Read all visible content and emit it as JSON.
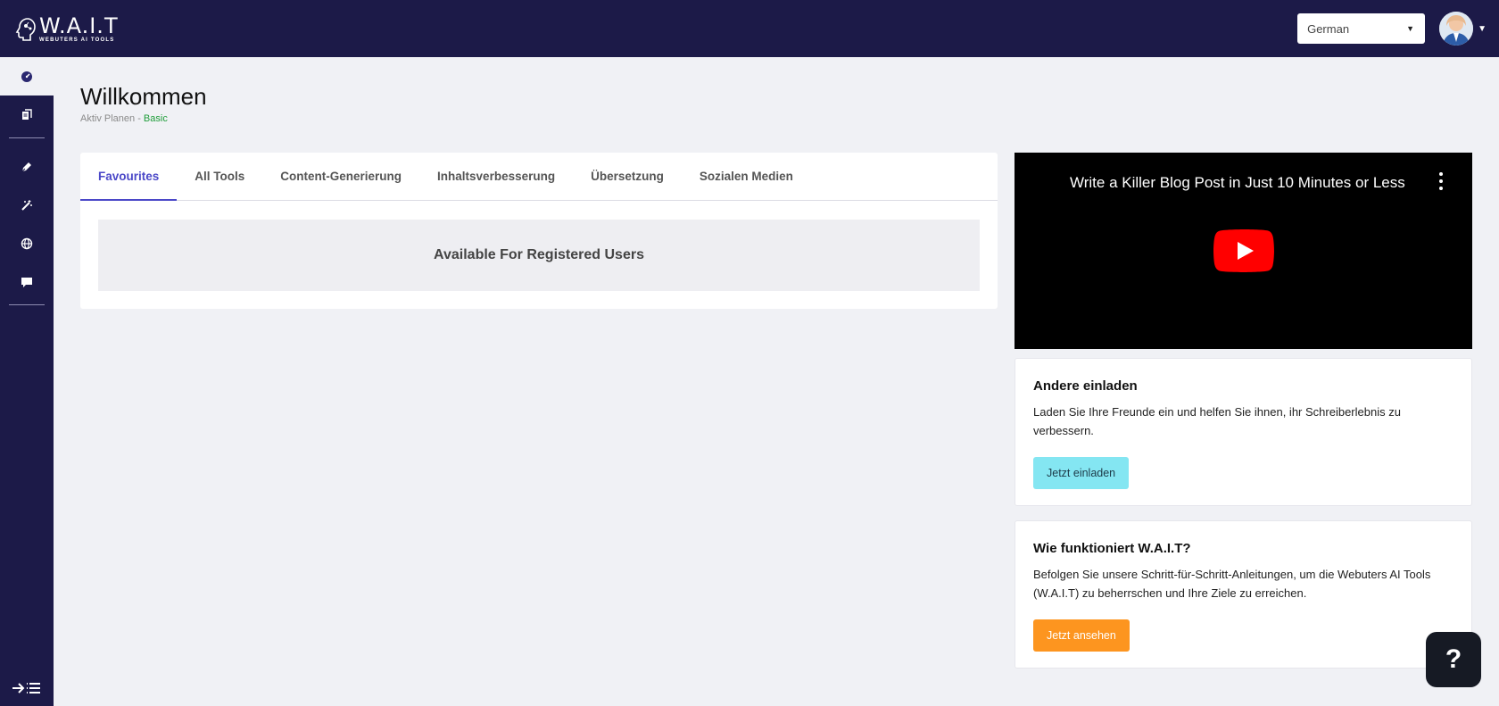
{
  "header": {
    "logo_title": "W.A.I.T",
    "logo_subtitle": "WEBUTERS AI TOOLS",
    "language_selected": "German",
    "avatar_icon": "user-avatar",
    "colors": {
      "header_bg": "#1c1a48"
    }
  },
  "sidebar": {
    "items": [
      {
        "icon": "dashboard-icon",
        "active": true
      },
      {
        "icon": "documents-icon"
      },
      {
        "icon": "pen-icon"
      },
      {
        "icon": "magic-wand-icon"
      },
      {
        "icon": "globe-icon"
      },
      {
        "icon": "chat-icon"
      }
    ],
    "toggle_icon": "expand-sidebar-icon"
  },
  "welcome": {
    "title": "Willkommen",
    "plan_label": "Aktiv Planen - ",
    "plan_value": "Basic"
  },
  "tools": {
    "tabs": [
      {
        "label": "Favourites",
        "active": true
      },
      {
        "label": "All Tools"
      },
      {
        "label": "Content-Generierung"
      },
      {
        "label": "Inhaltsverbesserung"
      },
      {
        "label": "Übersetzung"
      },
      {
        "label": "Sozialen Medien"
      }
    ],
    "notice": "Available For Registered Users"
  },
  "video": {
    "title": "Write a Killer Blog Post in Just 10 Minutes or Less",
    "play_icon": "youtube-play-icon"
  },
  "invite": {
    "title": "Andere einladen",
    "text": "Laden Sie Ihre Freunde ein und helfen Sie ihnen, ihr Schreiberlebnis zu verbessern.",
    "button": "Jetzt einladen"
  },
  "howto": {
    "title": "Wie funktioniert W.A.I.T?",
    "text": "Befolgen Sie unsere Schritt-für-Schritt-Anleitungen, um die Webuters AI Tools (W.A.I.T) zu beherrschen und Ihre Ziele zu erreichen.",
    "button": "Jetzt ansehen"
  },
  "help": {
    "label": "?"
  }
}
